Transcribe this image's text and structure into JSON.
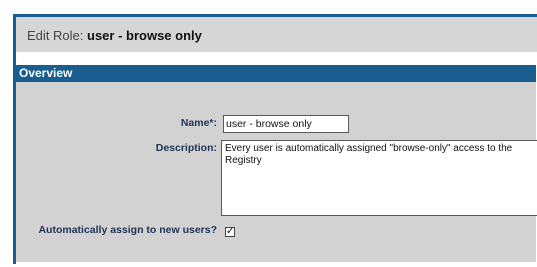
{
  "title": {
    "prefix": "Edit Role:",
    "role_name": "user - browse only"
  },
  "overview": {
    "header": "Overview",
    "name_label": "Name*:",
    "name_value": "user - browse only",
    "description_label": "Description:",
    "description_value": "Every user is automatically assigned \"browse-only\" access to the Registry",
    "auto_assign_label": "Automatically assign to new users?",
    "auto_assign_checked": true,
    "checkbox_glyph": "✓"
  },
  "colors": {
    "frame_blue": "#1a5e8f",
    "title_bar_gray": "#d6d6d6",
    "body_gray": "#d2d2d2",
    "label_navy": "#1f3355"
  }
}
